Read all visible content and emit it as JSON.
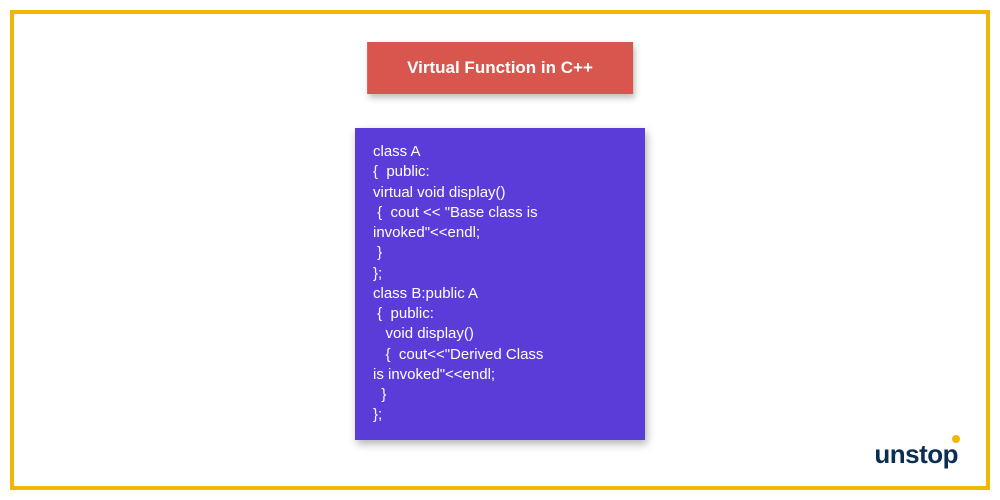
{
  "title": "Virtual Function in C++",
  "code": "class A\n{  public:\nvirtual void display()\n {  cout << \"Base class is\ninvoked\"<<endl;\n }\n};\nclass B:public A\n {  public:\n   void display()\n   {  cout<<\"Derived Class\nis invoked\"<<endl;\n  }\n};",
  "logo_text": "unstop"
}
